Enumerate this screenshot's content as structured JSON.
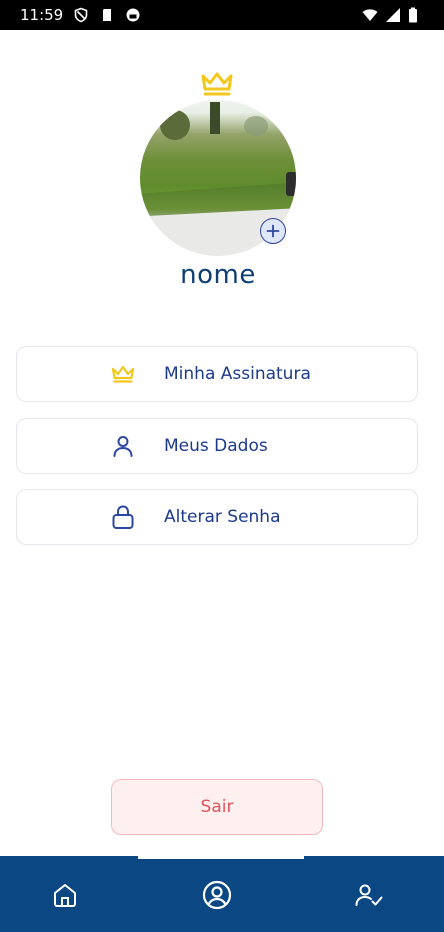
{
  "status_bar": {
    "time": "11:59",
    "left_icons": [
      "shield-icon",
      "sim-card-icon",
      "record-icon"
    ],
    "right_icons": [
      "wifi-icon",
      "signal-icon",
      "battery-icon"
    ]
  },
  "profile": {
    "name": "nome",
    "badge_icon": "crown-icon",
    "add_photo_icon": "plus-circle-icon"
  },
  "menu": {
    "items": [
      {
        "label": "Minha Assinatura",
        "icon": "crown-icon"
      },
      {
        "label": "Meus Dados",
        "icon": "user-icon"
      },
      {
        "label": "Alterar Senha",
        "icon": "lock-icon"
      }
    ]
  },
  "logout": {
    "label": "Sair"
  },
  "bottom_nav": {
    "items": [
      {
        "icon": "home-icon",
        "active": false
      },
      {
        "icon": "user-circle-icon",
        "active": true
      },
      {
        "icon": "user-check-icon",
        "active": false
      }
    ]
  },
  "colors": {
    "primary": "#0b4783",
    "menu_text": "#1b3a8a",
    "crown": "#f2c81c",
    "logout_text": "#e0535a",
    "logout_bg": "#fff0f0",
    "logout_border": "#f5b9bd"
  }
}
